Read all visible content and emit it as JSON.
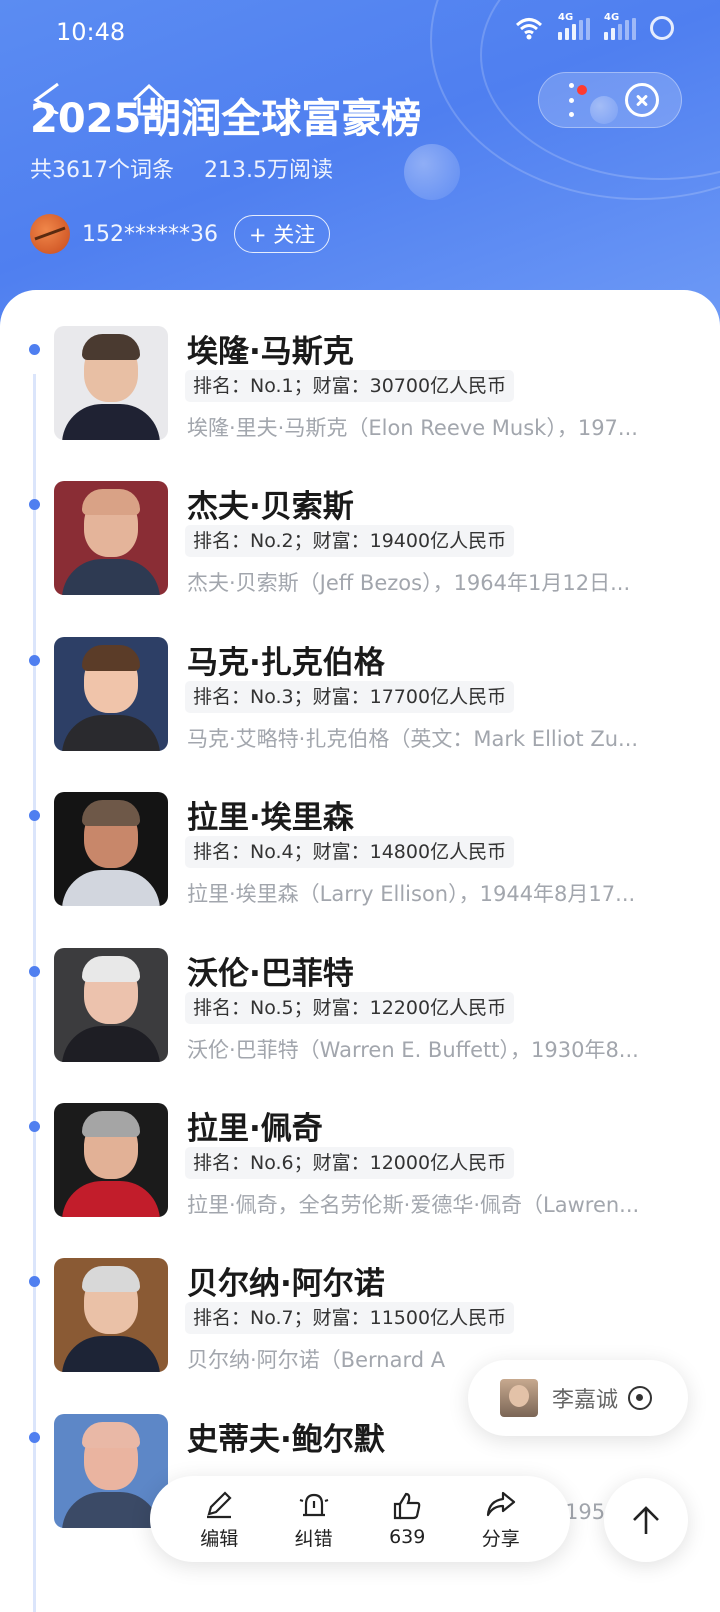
{
  "status_bar": {
    "time": "10:48",
    "net1": "4G",
    "net2": "4G"
  },
  "header": {
    "title": "2025胡润全球富豪榜",
    "stats": {
      "entries": "共3617个词条",
      "reads": "213.5万阅读"
    },
    "author": {
      "name": "152******36",
      "follow_label": "+ 关注"
    }
  },
  "colors": {
    "accent": "#4f7ff0",
    "hero_bg": "#5b8cf2",
    "desc_gray": "#a2a6ad"
  },
  "list": [
    {
      "name": "埃隆·马斯克",
      "tag": "排名：No.1；财富：30700亿人民币",
      "desc": "埃隆·里夫·马斯克（Elon Reeve Musk），197...",
      "photo": {
        "bg": "#e9e9ec",
        "skin": "#e8bfa4",
        "hair": "#4a3a30",
        "suit": "#1f2233"
      }
    },
    {
      "name": "杰夫·贝索斯",
      "tag": "排名：No.2；财富：19400亿人民币",
      "desc": "杰夫·贝索斯（Jeff Bezos），1964年1月12日...",
      "photo": {
        "bg": "#8a2d35",
        "skin": "#e4b49a",
        "hair": "#d9a286",
        "suit": "#2e3a52"
      }
    },
    {
      "name": "马克·扎克伯格",
      "tag": "排名：No.3；财富：17700亿人民币",
      "desc": "马克·艾略特·扎克伯格（英文：Mark Elliot Zu...",
      "photo": {
        "bg": "#2d3f66",
        "skin": "#f0c4aa",
        "hair": "#5b3c28",
        "suit": "#2a2a2e"
      }
    },
    {
      "name": "拉里·埃里森",
      "tag": "排名：No.4；财富：14800亿人民币",
      "desc": "拉里·埃里森（Larry Ellison），1944年8月17...",
      "photo": {
        "bg": "#141414",
        "skin": "#c8876a",
        "hair": "#6e5848",
        "suit": "#d2d6de"
      }
    },
    {
      "name": "沃伦·巴菲特",
      "tag": "排名：No.5；财富：12200亿人民币",
      "desc": "沃伦·巴菲特（Warren E. Buffett），1930年8...",
      "photo": {
        "bg": "#3c3c3e",
        "skin": "#ecc2ad",
        "hair": "#e8e8e8",
        "suit": "#1e1e24"
      }
    },
    {
      "name": "拉里·佩奇",
      "tag": "排名：No.6；财富：12000亿人民币",
      "desc": "拉里·佩奇，全名劳伦斯·爱德华·佩奇（Lawren...",
      "photo": {
        "bg": "#1b1b1b",
        "skin": "#e2b196",
        "hair": "#a5a5a5",
        "suit": "#c21d2b"
      }
    },
    {
      "name": "贝尔纳·阿尔诺",
      "tag": "排名：No.7；财富：11500亿人民币",
      "desc": "贝尔纳·阿尔诺（Bernard A",
      "photo": {
        "bg": "#8a5a34",
        "skin": "#eac1a7",
        "hair": "#d8d8d8",
        "suit": "#1d2436"
      }
    },
    {
      "name": "史蒂夫·鲍尔默",
      "tag": "",
      "desc": "1956",
      "photo": {
        "bg": "#5d87c7",
        "skin": "#eab4a0",
        "hair": "#e9b8a6",
        "suit": "#3b4a66"
      }
    }
  ],
  "float_chip": {
    "name": "李嘉诚"
  },
  "toolbar": {
    "edit": "编辑",
    "correct": "纠错",
    "likes": "639",
    "share": "分享"
  }
}
